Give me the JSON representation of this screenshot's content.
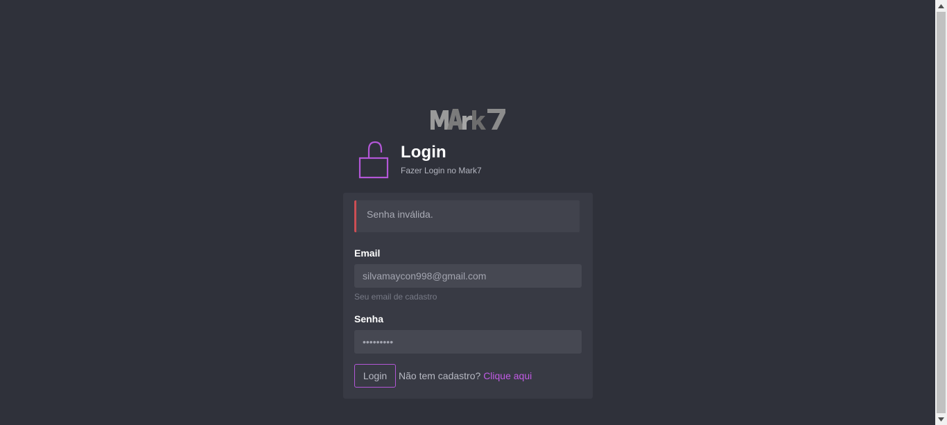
{
  "brand": {
    "logo_text": "MArk7"
  },
  "header": {
    "title": "Login",
    "subtitle": "Fazer Login no Mark7",
    "icon": "lock-open-icon"
  },
  "alert": {
    "message": "Senha inválida.",
    "accent_color": "#cc4e54"
  },
  "form": {
    "email": {
      "label": "Email",
      "value": "silvamaycon998@gmail.com",
      "help": "Seu email de cadastro"
    },
    "password": {
      "label": "Senha",
      "value": "123456789"
    },
    "login_label": "Login",
    "signup_prompt": "Não tem cadastro?",
    "signup_link": "Clique aqui"
  },
  "theme": {
    "background": "#2f313a",
    "card": "#383a44",
    "accent": "#b457d8"
  }
}
